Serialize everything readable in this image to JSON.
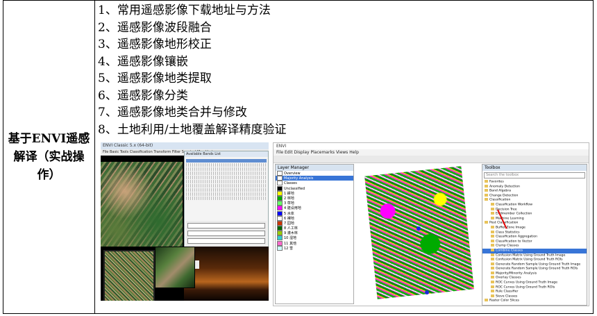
{
  "row_label": "基于ENVI遥感解译（实战操作）",
  "steps": [
    "1、常用遥感影像下载地址与方法",
    "2、遥感影像波段融合",
    "3、遥感影像地形校正",
    "4、遥感影像镶嵌",
    "5、遥感影像地类提取",
    "6、遥感影像分类",
    "7、遥感影像地类合并与修改",
    "8、土地利用/土地覆盖解译精度验证"
  ],
  "screenshot_left": {
    "title": "ENVI Classic 5.x (64-bit)",
    "menu": "File  Basic Tools  Classification  Transform  Filter  Spectral  Map  Vector",
    "bandlist_title": "Available Bands List"
  },
  "screenshot_right": {
    "title": "ENVI",
    "menu": "File  Edit  Display  Placemarks  Views  Help",
    "layer_manager": {
      "title": "Layer Manager",
      "rows": [
        {
          "label": "Overview",
          "color": "#ffffff"
        },
        {
          "label": "Majority Analysis",
          "color": "#ffffff",
          "selected": true
        },
        {
          "label": "Classes",
          "color": "#ffffff"
        },
        {
          "label": "Unclassified",
          "color": "#000000"
        },
        {
          "label": "1 耕地",
          "color": "#ffff00"
        },
        {
          "label": "2 林地",
          "color": "#00aa00"
        },
        {
          "label": "3 草地",
          "color": "#66ff66"
        },
        {
          "label": "4 建设用地",
          "color": "#ff00ff"
        },
        {
          "label": "5 水体",
          "color": "#0000ff"
        },
        {
          "label": "6 裸地",
          "color": "#ffffff"
        },
        {
          "label": "7 园地",
          "color": "#cc3300"
        },
        {
          "label": "8 人工林",
          "color": "#006600"
        },
        {
          "label": "9 灌木林",
          "color": "#99cc00"
        },
        {
          "label": "10 湿地",
          "color": "#33cccc"
        },
        {
          "label": "11 其他",
          "color": "#ff66cc"
        },
        {
          "label": "12 雪",
          "color": "#ccffff"
        }
      ]
    },
    "toolbox": {
      "title": "Toolbox",
      "search": "Search the toolbox",
      "rows": [
        "Favorites",
        "Anomaly Detection",
        "Band Algebra",
        "Change Detection",
        "Classification",
        "Classification Workflow",
        "Decision Tree",
        "Endmember Collection",
        "Machine Learning",
        "Post Classification",
        "Buffer Zone Image",
        "Class Statistics",
        "Classification Aggregation",
        "Classification to Vector",
        "Clump Classes",
        "Combine Classes",
        "Confusion Matrix Using Ground Truth Image",
        "Confusion Matrix Using Ground Truth ROIs",
        "Generate Random Sample Using Ground Truth Image",
        "Generate Random Sample Using Ground Truth ROIs",
        "Majority/Minority Analysis",
        "Overlay Classes",
        "ROC Curves Using Ground Truth Image",
        "ROC Curves Using Ground Truth ROIs",
        "Rule Classifier",
        "Sieve Classes",
        "Raster Color Slices"
      ],
      "highlighted_index": 15
    }
  }
}
